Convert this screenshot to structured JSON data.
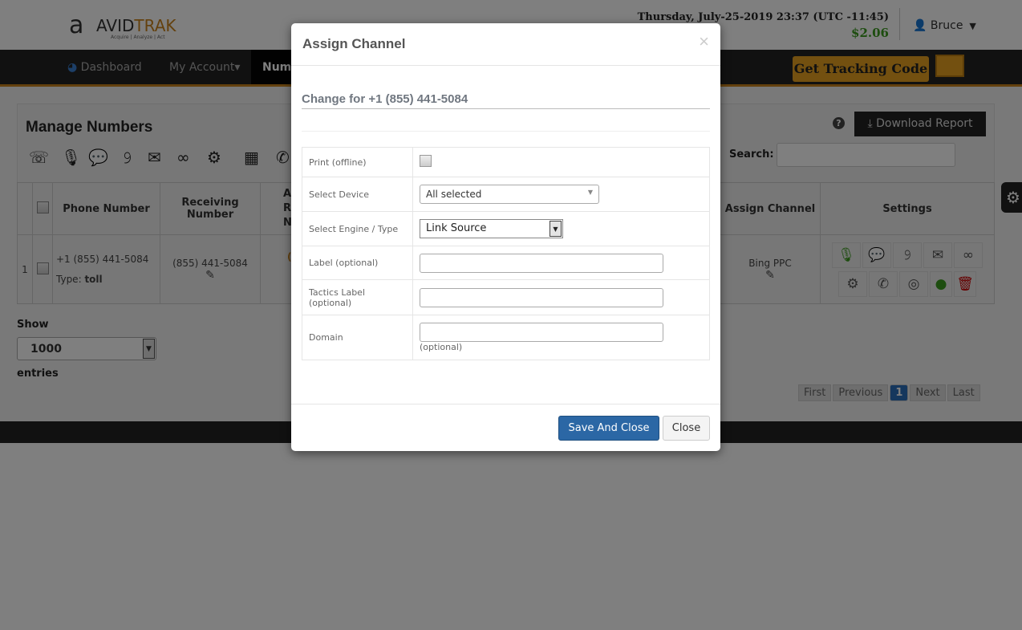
{
  "header": {
    "logo_mark": "a",
    "logo_avid": "AVID",
    "logo_trak": "TRAK",
    "logo_tagline": "Acquire | Analyze | Act",
    "datetime": "Thursday, July-25-2019 23:37 (UTC -11:45)",
    "balance": "$2.06",
    "user": "Bruce",
    "user_icon": "user-icon"
  },
  "nav": {
    "items": [
      {
        "label": "Dashboard",
        "icon": "dashboard-icon"
      },
      {
        "label": "My Account▾"
      },
      {
        "label": "Numb"
      }
    ],
    "get_tracking_code": "Get Tracking Code"
  },
  "page": {
    "title": "Manage Numbers",
    "download_report": "Download Report",
    "search_label": "Search:",
    "search_value": "",
    "columns": [
      "",
      "Phone Number",
      "Receiving Number",
      "A\nR\nN",
      "Assign Channel",
      "Settings"
    ],
    "rows": [
      {
        "index": "1",
        "phone": "+1 (855) 441-5084",
        "type_label": "Type:",
        "type": "toll",
        "receiving": "(855) 441-5084",
        "channel_partial": "(",
        "assign_channel": "Bing PPC"
      }
    ],
    "show_label": "Show",
    "show_value": "1000",
    "entries_label": "entries",
    "pager": [
      "First",
      "Previous",
      "1",
      "Next",
      "Last"
    ]
  },
  "modal": {
    "title": "Assign Channel",
    "close_x": "×",
    "subtitle": "Change for +1 (855) 441-5084",
    "fields": [
      {
        "label": "Print (offline)"
      },
      {
        "label": "Select Device",
        "value": "All selected"
      },
      {
        "label": "Select Engine / Type",
        "value": "Link Source"
      },
      {
        "label": "Label (optional)",
        "value": ""
      },
      {
        "label": "Tactics Label (optional)",
        "value": ""
      },
      {
        "label": "Domain",
        "value": "",
        "hint": "(optional)"
      }
    ],
    "save": "Save And Close",
    "close": "Close"
  },
  "colors": {
    "accent": "#c8821c",
    "primary": "#2b67a5",
    "balance": "#3a9a1f",
    "delete": "#cc0000"
  }
}
